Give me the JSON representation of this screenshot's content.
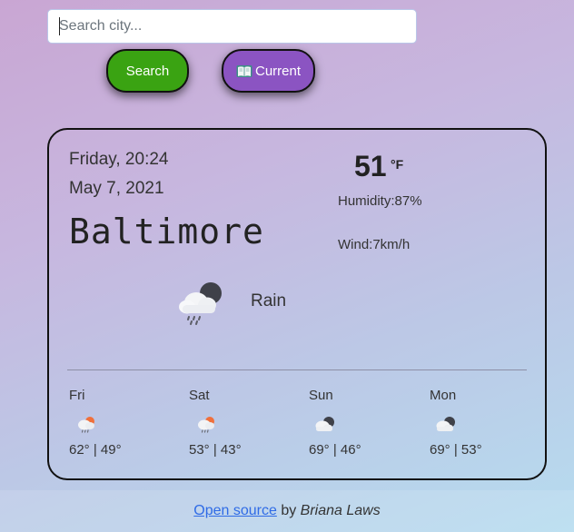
{
  "search": {
    "placeholder": "Search city...",
    "button_label": "Search"
  },
  "current_button": {
    "label": "Current",
    "icon": "book-icon"
  },
  "weather": {
    "day_time": "Friday, 20:24",
    "date": "May 7, 2021",
    "city": "Baltimore",
    "temperature": "51",
    "unit": "°F",
    "humidity": "Humidity:87%",
    "wind": "Wind:7km/h",
    "description": "Rain",
    "icon": "rain-night-icon"
  },
  "forecast": [
    {
      "day": "Fri",
      "temps": "62° | 49°",
      "icon": "rain-sun-icon"
    },
    {
      "day": "Sat",
      "temps": "53° | 43°",
      "icon": "rain-sun-icon"
    },
    {
      "day": "Sun",
      "temps": "69° | 46°",
      "icon": "cloud-night-icon"
    },
    {
      "day": "Mon",
      "temps": "69° | 53°",
      "icon": "cloud-night-icon"
    }
  ],
  "footer": {
    "link_text": "Open source",
    "by_text": " by ",
    "author": "Briana Laws"
  },
  "colors": {
    "search_button": "#3aa312",
    "current_button": "#8b54c2",
    "link": "#2f6be6"
  }
}
